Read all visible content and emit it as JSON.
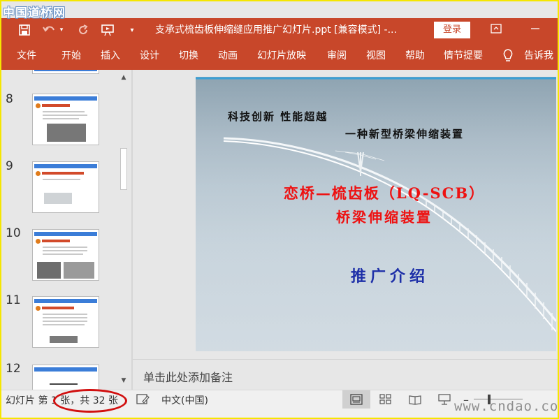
{
  "watermark_top": "中国道桥网",
  "watermark_bottom": "www.cndao.com",
  "titlebar": {
    "document_title": "支承式梳齿板伸缩缝应用推广幻灯片.ppt [兼容模式]  -...",
    "login_label": "登录"
  },
  "ribbon": {
    "tabs": [
      "文件",
      "开始",
      "插入",
      "设计",
      "切换",
      "动画",
      "幻灯片放映",
      "审阅",
      "视图",
      "帮助",
      "情节提要",
      "告诉我"
    ]
  },
  "thumbnails": [
    {
      "number": "8"
    },
    {
      "number": "9"
    },
    {
      "number": "10"
    },
    {
      "number": "11"
    },
    {
      "number": "12"
    }
  ],
  "slide": {
    "slogan_line1": "科技创新  性能超越",
    "slogan_line2": "一种新型桥梁伸缩装置",
    "title_line1": "恋桥—梳齿板（LQ-SCB）",
    "title_line2": "桥梁伸缩装置",
    "subtitle": "推广介绍",
    "colors": {
      "title": "#ee1111",
      "subtitle": "#1d2fa8"
    }
  },
  "notes": {
    "placeholder": "单击此处添加备注"
  },
  "statusbar": {
    "slide_info": "幻灯片 第 1 张，共 32 张",
    "language": "中文(中国)"
  },
  "theme": {
    "accent": "#c8472a"
  }
}
